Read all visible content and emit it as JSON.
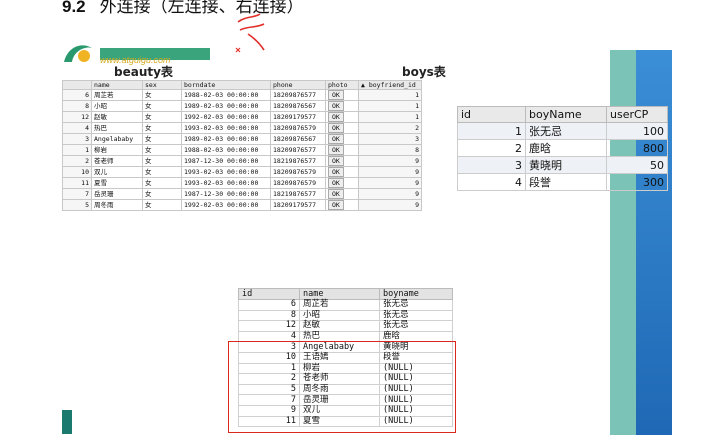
{
  "heading": {
    "number": "9.2",
    "title": "外连接（左连接、右连接）"
  },
  "logo": {
    "url": "www.atguigu.com"
  },
  "labels": {
    "beauty": "beauty表",
    "boys": "boys表"
  },
  "beauty_table": {
    "headers": [
      "",
      "name",
      "sex",
      "borndate",
      "phone",
      "photo",
      "▲ boyfriend_id"
    ],
    "rows": [
      [
        "6",
        "周芷若",
        "女",
        "1988-02-03 00:00:00",
        "18209876577",
        "OK",
        "1"
      ],
      [
        "8",
        "小昭",
        "女",
        "1989-02-03 00:00:00",
        "18209876567",
        "OK",
        "1"
      ],
      [
        "12",
        "赵敏",
        "女",
        "1992-02-03 00:00:00",
        "18209179577",
        "OK",
        "1"
      ],
      [
        "4",
        "热巴",
        "女",
        "1993-02-03 00:00:00",
        "18209876579",
        "OK",
        "2"
      ],
      [
        "3",
        "Angelababy",
        "女",
        "1989-02-03 00:00:00",
        "18209876567",
        "OK",
        "3"
      ],
      [
        "1",
        "柳岩",
        "女",
        "1988-02-03 00:00:00",
        "18209876577",
        "OK",
        "8"
      ],
      [
        "2",
        "苍老师",
        "女",
        "1987-12-30 00:00:00",
        "18219876577",
        "OK",
        "9"
      ],
      [
        "10",
        "双儿",
        "女",
        "1993-02-03 00:00:00",
        "18209876579",
        "OK",
        "9"
      ],
      [
        "11",
        "夏雪",
        "女",
        "1993-02-03 00:00:00",
        "18209876579",
        "OK",
        "9"
      ],
      [
        "7",
        "岳灵珊",
        "女",
        "1987-12-30 00:00:00",
        "18219876577",
        "OK",
        "9"
      ],
      [
        "5",
        "周冬雨",
        "女",
        "1992-02-03 00:00:00",
        "18209179577",
        "OK",
        "9"
      ]
    ]
  },
  "boys_table": {
    "headers": [
      "id",
      "boyName",
      "userCP"
    ],
    "rows": [
      [
        "1",
        "张无忌",
        "100"
      ],
      [
        "2",
        "鹿晗",
        "800"
      ],
      [
        "3",
        "黄晓明",
        "50"
      ],
      [
        "4",
        "段誉",
        "300"
      ]
    ]
  },
  "result_table": {
    "headers": [
      "id",
      "name",
      "boyname"
    ],
    "rows": [
      [
        "6",
        "周芷若",
        "张无忌"
      ],
      [
        "8",
        "小昭",
        "张无忌"
      ],
      [
        "12",
        "赵敏",
        "张无忌"
      ],
      [
        "4",
        "热巴",
        "鹿晗"
      ],
      [
        "3",
        "Angelababy",
        "黄晓明"
      ],
      [
        "10",
        "王语嫣",
        "段誉"
      ],
      [
        "1",
        "柳岩",
        "(NULL)"
      ],
      [
        "2",
        "苍老师",
        "(NULL)"
      ],
      [
        "5",
        "周冬雨",
        "(NULL)"
      ],
      [
        "7",
        "岳灵珊",
        "(NULL)"
      ],
      [
        "9",
        "双儿",
        "(NULL)"
      ],
      [
        "11",
        "夏雪",
        "(NULL)"
      ]
    ]
  },
  "colors": {
    "highlight_box": "#d9281d",
    "annotation": "#e0302a",
    "slide_accent": "#2d7fc7"
  }
}
